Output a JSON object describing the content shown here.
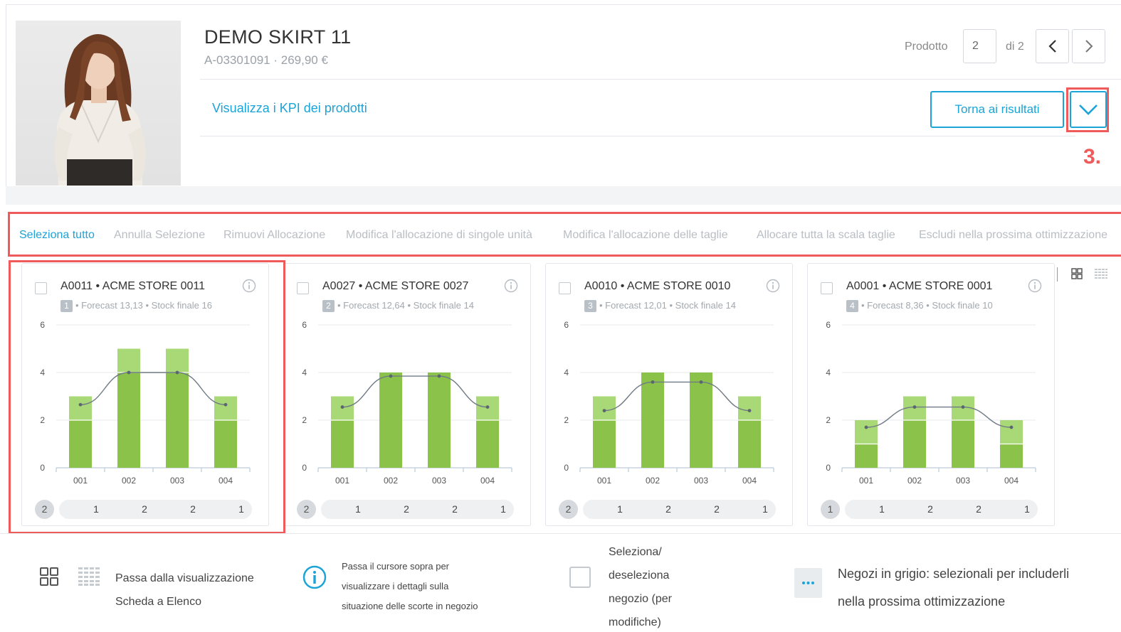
{
  "product": {
    "title": "DEMO SKIRT 11",
    "subtitle": "A-03301091 · 269,90 €",
    "kpi_link": "Visualizza i KPI dei prodotti",
    "image_alt": "woman-in-white-blouse-and-black-skirt"
  },
  "pager": {
    "label": "Prodotto",
    "current": "2",
    "of_label": "di 2",
    "back_button": "Torna ai risultati"
  },
  "annotation": {
    "step": "3."
  },
  "toolbar": {
    "actions": [
      "Seleziona tutto",
      "Annulla Selezione",
      "Rimuovi Allocazione",
      "Modifica l'allocazione di singole unità",
      "Modifica l'allocazione delle taglie",
      "Allocare tutta la scala taglie",
      "Escludi nella prossima ottimizzazione"
    ]
  },
  "colors": {
    "accent": "#1ca3d8",
    "highlight": "#ef5a5a",
    "bar_dark": "#8bc34a",
    "bar_light": "#a9d977",
    "muted_text": "#b9bec4"
  },
  "chart_data": [
    {
      "type": "bar",
      "categories": [
        "001",
        "002",
        "003",
        "004"
      ],
      "series": [
        {
          "values": [
            2,
            4,
            4,
            2
          ]
        },
        {
          "values": [
            1,
            1,
            1,
            1
          ]
        }
      ],
      "line": [
        2.65,
        4.0,
        4.0,
        2.65
      ],
      "yticks": [
        "0",
        "2",
        "4",
        "6"
      ],
      "ylim": [
        0,
        6
      ]
    },
    {
      "type": "bar",
      "categories": [
        "001",
        "002",
        "003",
        "004"
      ],
      "series": [
        {
          "values": [
            2,
            4,
            4,
            2
          ]
        },
        {
          "values": [
            1,
            0,
            0,
            1
          ]
        }
      ],
      "line": [
        2.55,
        3.85,
        3.85,
        2.55
      ],
      "yticks": [
        "0",
        "2",
        "4",
        "6"
      ],
      "ylim": [
        0,
        6
      ]
    },
    {
      "type": "bar",
      "categories": [
        "001",
        "002",
        "003",
        "004"
      ],
      "series": [
        {
          "values": [
            2,
            4,
            4,
            2
          ]
        },
        {
          "values": [
            1,
            0,
            0,
            1
          ]
        }
      ],
      "line": [
        2.4,
        3.6,
        3.6,
        2.4
      ],
      "yticks": [
        "0",
        "2",
        "4",
        "6"
      ],
      "ylim": [
        0,
        6
      ]
    },
    {
      "type": "bar",
      "categories": [
        "001",
        "002",
        "003",
        "004"
      ],
      "series": [
        {
          "values": [
            1,
            2,
            2,
            1
          ]
        },
        {
          "values": [
            1,
            1,
            1,
            1
          ]
        }
      ],
      "line": [
        1.7,
        2.55,
        2.55,
        1.7
      ],
      "yticks": [
        "0",
        "2",
        "4",
        "6"
      ],
      "ylim": [
        0,
        6
      ]
    }
  ],
  "stores": [
    {
      "title": "A0011 • ACME STORE 0011",
      "rank": "1",
      "details": "• Forecast 13,13 • Stock finale 16",
      "total": "2",
      "alloc": [
        "1",
        "2",
        "2",
        "1"
      ]
    },
    {
      "title": "A0027 • ACME STORE 0027",
      "rank": "2",
      "details": "• Forecast 12,64 • Stock finale 14",
      "total": "2",
      "alloc": [
        "1",
        "2",
        "2",
        "1"
      ]
    },
    {
      "title": "A0010 • ACME STORE 0010",
      "rank": "3",
      "details": "• Forecast 12,01 • Stock finale 14",
      "total": "2",
      "alloc": [
        "1",
        "2",
        "2",
        "1"
      ]
    },
    {
      "title": "A0001 • ACME STORE 0001",
      "rank": "4",
      "details": "• Forecast 8,36 • Stock finale 10",
      "total": "1",
      "alloc": [
        "1",
        "2",
        "2",
        "1"
      ]
    }
  ],
  "legend": {
    "view_switch": [
      "Passa dalla visualizzazione",
      "Scheda a Elenco"
    ],
    "info_hover": [
      "Passa il cursore sopra per",
      "visualizzare i dettagli sulla",
      "situazione delle scorte in negozio"
    ],
    "select_toggle": [
      "Seleziona/",
      "deseleziona",
      "negozio (per",
      "modifiche)"
    ],
    "gray_stores": [
      "Negozi in grigio: selezionali per includerli",
      "nella prossima ottimizzazione"
    ]
  }
}
